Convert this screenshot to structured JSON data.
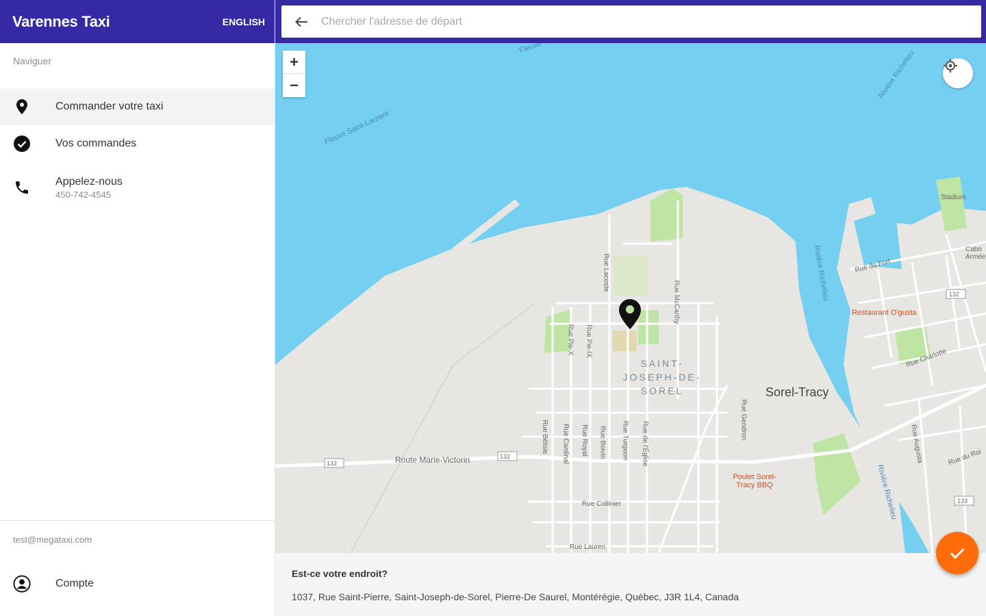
{
  "sidebar": {
    "title": "Varennes Taxi",
    "language_button": "ENGLISH",
    "nav_heading": "Naviguer",
    "items": [
      {
        "label": "Commander votre taxi",
        "icon": "location-pin-icon",
        "active": true
      },
      {
        "label": "Vos commandes",
        "icon": "check-circle-icon"
      },
      {
        "label": "Appelez-nous",
        "sublabel": "450-742-4545",
        "icon": "phone-icon"
      }
    ],
    "user_email": "test@megataxi.com",
    "account_label": "Compte",
    "account_icon": "account-circle-icon"
  },
  "search": {
    "placeholder": "Chercher l'adresse de départ",
    "value": ""
  },
  "map": {
    "zoom_in": "+",
    "zoom_out": "−",
    "labels": {
      "fleuve_top": "Fleuve",
      "fleuve": "Fleuve Saint-Laurent",
      "riviere_top": "Rivière Richelieu",
      "riviere_mid": "Rivière Richelieu",
      "riviere_low": "Rivière Richelieu",
      "district": "SAINT-JOSEPH-DE-SOREL",
      "city": "Sorel-Tracy",
      "route": "Route Marie-Victorin",
      "route_shield_1": "132",
      "route_shield_2": "132",
      "route_shield_3": "132",
      "route_shield_4": "133",
      "restaurant": "Restaurant O'gusta",
      "poulet": "Poulet Sorel-Tracy BBQ",
      "stadium": "Stadium",
      "fort": "Rue du Fort",
      "charlotte": "Rue Charlotte",
      "cdc": "Cabo Armée",
      "collinier": "Rue Collinier",
      "lauren": "Rue Lauren",
      "mccarthy": "Rue McCarthy",
      "lacoste": "Rue Lacoste",
      "de_la_paix": "Rue Pie-IX",
      "pie": "Rue Pie-X",
      "rue_a": "Rue Bélisle",
      "rue_b": "Rue Cardinal",
      "rue_c": "Rue Royal",
      "rue_d": "Rue Boivin",
      "rue_e": "Rue Turgeon",
      "rue_f": "Rue de l'Église",
      "rue_g": "Rue Gendron",
      "rue_h": "Rue du Roi",
      "rue_i": "Rue Augusta"
    },
    "colors": {
      "water": "#75cff0",
      "land": "#e8e6e2",
      "park": "#bfe5a5",
      "road": "#ffffff",
      "accent": "#3529a6",
      "fab": "#ff6d0a"
    }
  },
  "confirm": {
    "title": "Est-ce votre endroit?",
    "address": "1037, Rue Saint-Pierre, Saint-Joseph-de-Sorel, Pierre-De Saurel, Montérégie, Québec, J3R 1L4, Canada"
  }
}
